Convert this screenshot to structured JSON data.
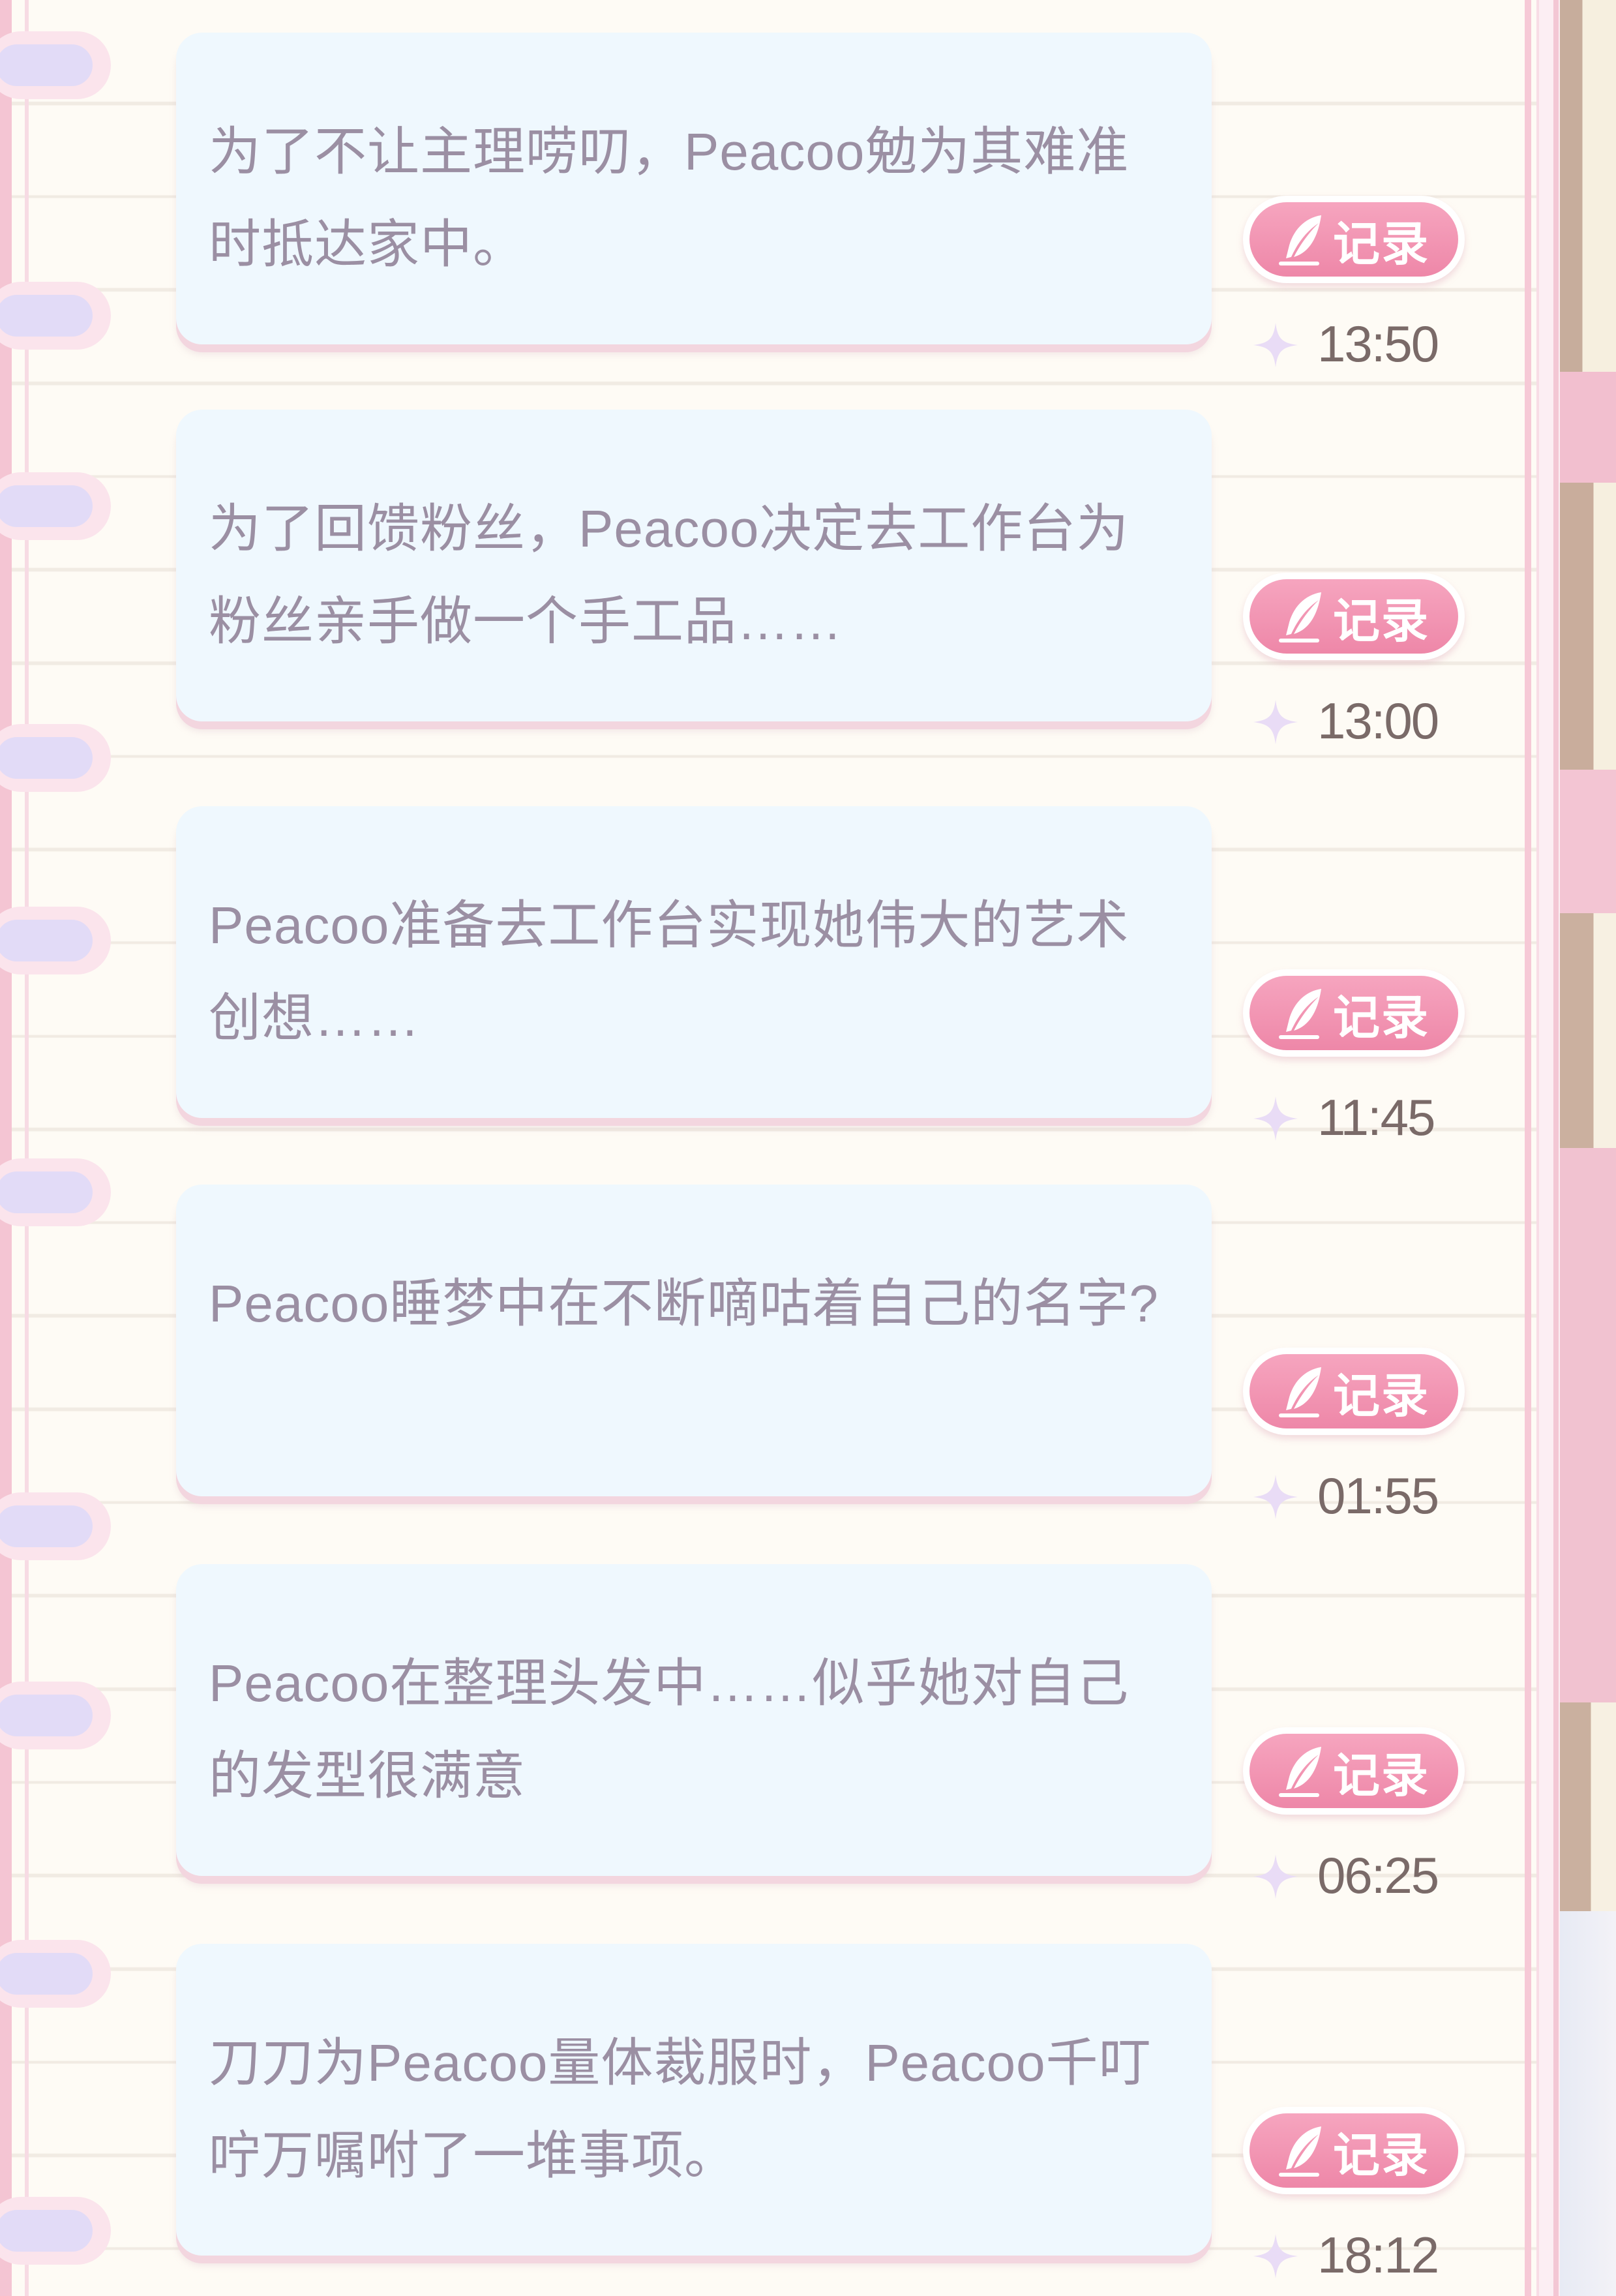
{
  "diary": {
    "record_label": "记录",
    "entries": [
      {
        "text": "为了不让主理唠叨，Peacoo勉为其难准时抵达家中。",
        "time": "13:50"
      },
      {
        "text": "为了回馈粉丝，Peacoo决定去工作台为粉丝亲手做一个手工品……",
        "time": "13:00"
      },
      {
        "text": "Peacoo准备去工作台实现她伟大的艺术创想……",
        "time": "11:45"
      },
      {
        "text": "Peacoo睡梦中在不断嘀咕着自己的名字?",
        "time": "01:55"
      },
      {
        "text": "Peacoo在整理头发中……似乎她对自己的发型很满意",
        "time": "06:25"
      },
      {
        "text": "刀刀为Peacoo量体裁服时，Peacoo千叮咛万嘱咐了一堆事项。",
        "time": "18:12"
      }
    ]
  },
  "icons": {
    "record": "quill-icon",
    "time": "sparkle-icon"
  },
  "colors": {
    "page_background": "#fefbf5",
    "card_background": "#eff8fe",
    "entry_text": "#9b8fa3",
    "record_button": "#ee87a8",
    "time_text": "#7a6a68",
    "sparkle": "#e9dcf6",
    "ring": "#e2dbf7"
  }
}
